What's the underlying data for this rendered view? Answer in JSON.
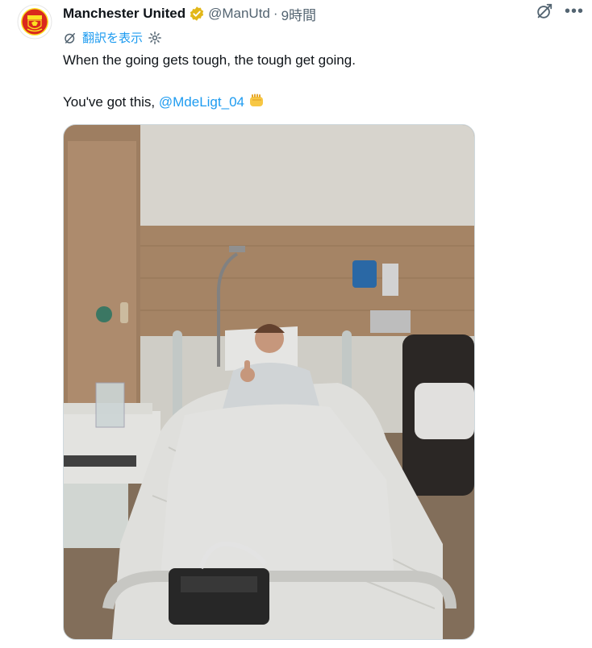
{
  "post": {
    "author_name": "Manchester United",
    "handle": "@ManUtd",
    "separator": "·",
    "time": "9時間",
    "translate_label": "翻訳を表示",
    "text_line1": "When the going gets tough, the tough get going.",
    "text_line2_prefix": "You've got this, ",
    "mention": "@MdeLigt_04",
    "emoji": "👊"
  },
  "icons": {
    "verified": "verified-badge-icon",
    "grok": "grok-icon",
    "more": "more-icon",
    "translate": "translate-icon",
    "settings": "gear-icon"
  },
  "colors": {
    "accent": "#1d9bf0",
    "secondary_text": "#536471",
    "verified_gold": "#e2b719",
    "club_red": "#da291c"
  }
}
